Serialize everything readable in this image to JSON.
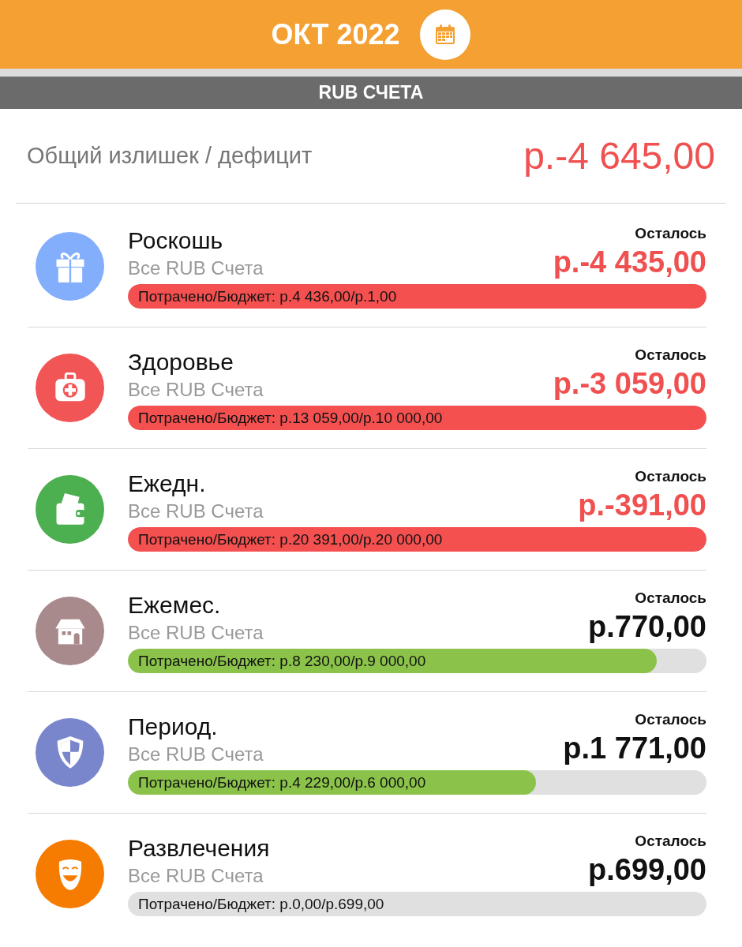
{
  "header": {
    "title": "ОКТ 2022"
  },
  "section": {
    "title": "RUB СЧЕТА"
  },
  "summary": {
    "label": "Общий излишек / дефицит",
    "amount": "р.-4 645,00",
    "negative": true
  },
  "categories": [
    {
      "kind": "gift",
      "color": "#82aefc",
      "name": "Роскошь",
      "account": "Все RUB Счета",
      "remaining_label": "Осталось",
      "remaining": "р.-4 435,00",
      "over_budget": true,
      "bar_text": "Потрачено/Бюджет: р.4 436,00/р.1,00",
      "level": 1
    },
    {
      "kind": "medkit",
      "color": "#f25555",
      "name": "Здоровье",
      "account": "Все RUB Счета",
      "remaining_label": "Осталось",
      "remaining": "р.-3 059,00",
      "over_budget": true,
      "bar_text": "Потрачено/Бюджет: р.13 059,00/р.10 000,00",
      "level": 1
    },
    {
      "kind": "wallet",
      "color": "#4caf50",
      "name": "Ежедн.",
      "account": "Все RUB Счета",
      "remaining_label": "Осталось",
      "remaining": "р.-391,00",
      "over_budget": true,
      "bar_text": "Потрачено/Бюджет: р.20 391,00/р.20 000,00",
      "level": 1
    },
    {
      "kind": "house",
      "color": "#a88a8c",
      "name": "Ежемес.",
      "account": "Все RUB Счета",
      "remaining_label": "Осталось",
      "remaining": "р.770,00",
      "over_budget": false,
      "bar_text": "Потрачено/Бюджет: р.8 230,00/р.9 000,00",
      "level": 0.914
    },
    {
      "kind": "shield",
      "color": "#7986cb",
      "name": "Период.",
      "account": "Все RUB Счета",
      "remaining_label": "Осталось",
      "remaining": "р.1 771,00",
      "over_budget": false,
      "bar_text": "Потрачено/Бюджет: р.4 229,00/р.6 000,00",
      "level": 0.705
    },
    {
      "kind": "mask",
      "color": "#f57c00",
      "name": "Развлечения",
      "account": "Все RUB Счета",
      "remaining_label": "Осталось",
      "remaining": "р.699,00",
      "over_budget": false,
      "bar_text": "Потрачено/Бюджет: р.0,00/р.699,00",
      "level": 0
    }
  ]
}
